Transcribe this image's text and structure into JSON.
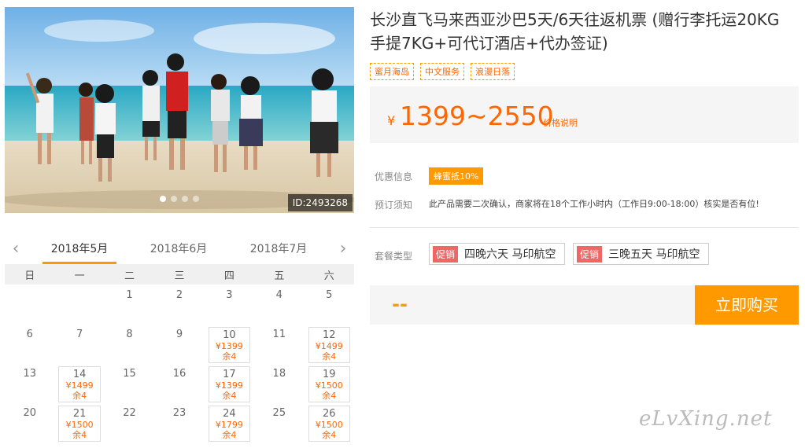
{
  "hero": {
    "id_label": "ID:2493268",
    "dots": 4,
    "active_dot": 0
  },
  "calendar": {
    "months": [
      "2018年5月",
      "2018年6月",
      "2018年7月"
    ],
    "active_month": 0,
    "weekdays": [
      "日",
      "一",
      "二",
      "三",
      "四",
      "五",
      "六"
    ],
    "weeks": [
      [
        {
          "d": ""
        },
        {
          "d": ""
        },
        {
          "d": "1"
        },
        {
          "d": "2"
        },
        {
          "d": "3"
        },
        {
          "d": "4"
        },
        {
          "d": "5"
        }
      ],
      [
        {
          "d": "6"
        },
        {
          "d": "7"
        },
        {
          "d": "8"
        },
        {
          "d": "9"
        },
        {
          "d": "10",
          "p": "¥1399",
          "s": "余4"
        },
        {
          "d": "11"
        },
        {
          "d": "12",
          "p": "¥1499",
          "s": "余4"
        }
      ],
      [
        {
          "d": "13"
        },
        {
          "d": "14",
          "p": "¥1499",
          "s": "余4"
        },
        {
          "d": "15"
        },
        {
          "d": "16"
        },
        {
          "d": "17",
          "p": "¥1399",
          "s": "余4"
        },
        {
          "d": "18"
        },
        {
          "d": "19",
          "p": "¥1500",
          "s": "余4"
        }
      ],
      [
        {
          "d": "20"
        },
        {
          "d": "21",
          "p": "¥1500",
          "s": "余4"
        },
        {
          "d": "22"
        },
        {
          "d": "23"
        },
        {
          "d": "24",
          "p": "¥1799",
          "s": "余4"
        },
        {
          "d": "25"
        },
        {
          "d": "26",
          "p": "¥1500",
          "s": "余4"
        }
      ]
    ]
  },
  "product": {
    "title": "长沙直飞马来西亚沙巴5天/6天往返机票 (赠行李托运20KG手提7KG+可代订酒店+代办签证)",
    "tags": [
      "蜜月海岛",
      "中文服务",
      "浪漫日落"
    ],
    "price_currency": "¥",
    "price_range": "1399~2550",
    "price_note": "价格说明",
    "promo_label": "优惠信息",
    "promo_badge": "蜂蜜抵10%",
    "notice_label": "预订须知",
    "notice_text": "此产品需要二次确认，商家将在18个工作小时内（工作日9:00-18:00）核实是否有位!",
    "package_label": "套餐类型",
    "packages": [
      {
        "hot": "促销",
        "name": "四晚六天 马印航空"
      },
      {
        "hot": "促销",
        "name": "三晚五天 马印航空"
      }
    ],
    "total_placeholder": "--",
    "buy_label": "立即购买"
  },
  "watermark": "eLvXing.net",
  "colors": {
    "accent": "#ff9900",
    "price": "#ff6600",
    "hot": "#ee6666"
  }
}
